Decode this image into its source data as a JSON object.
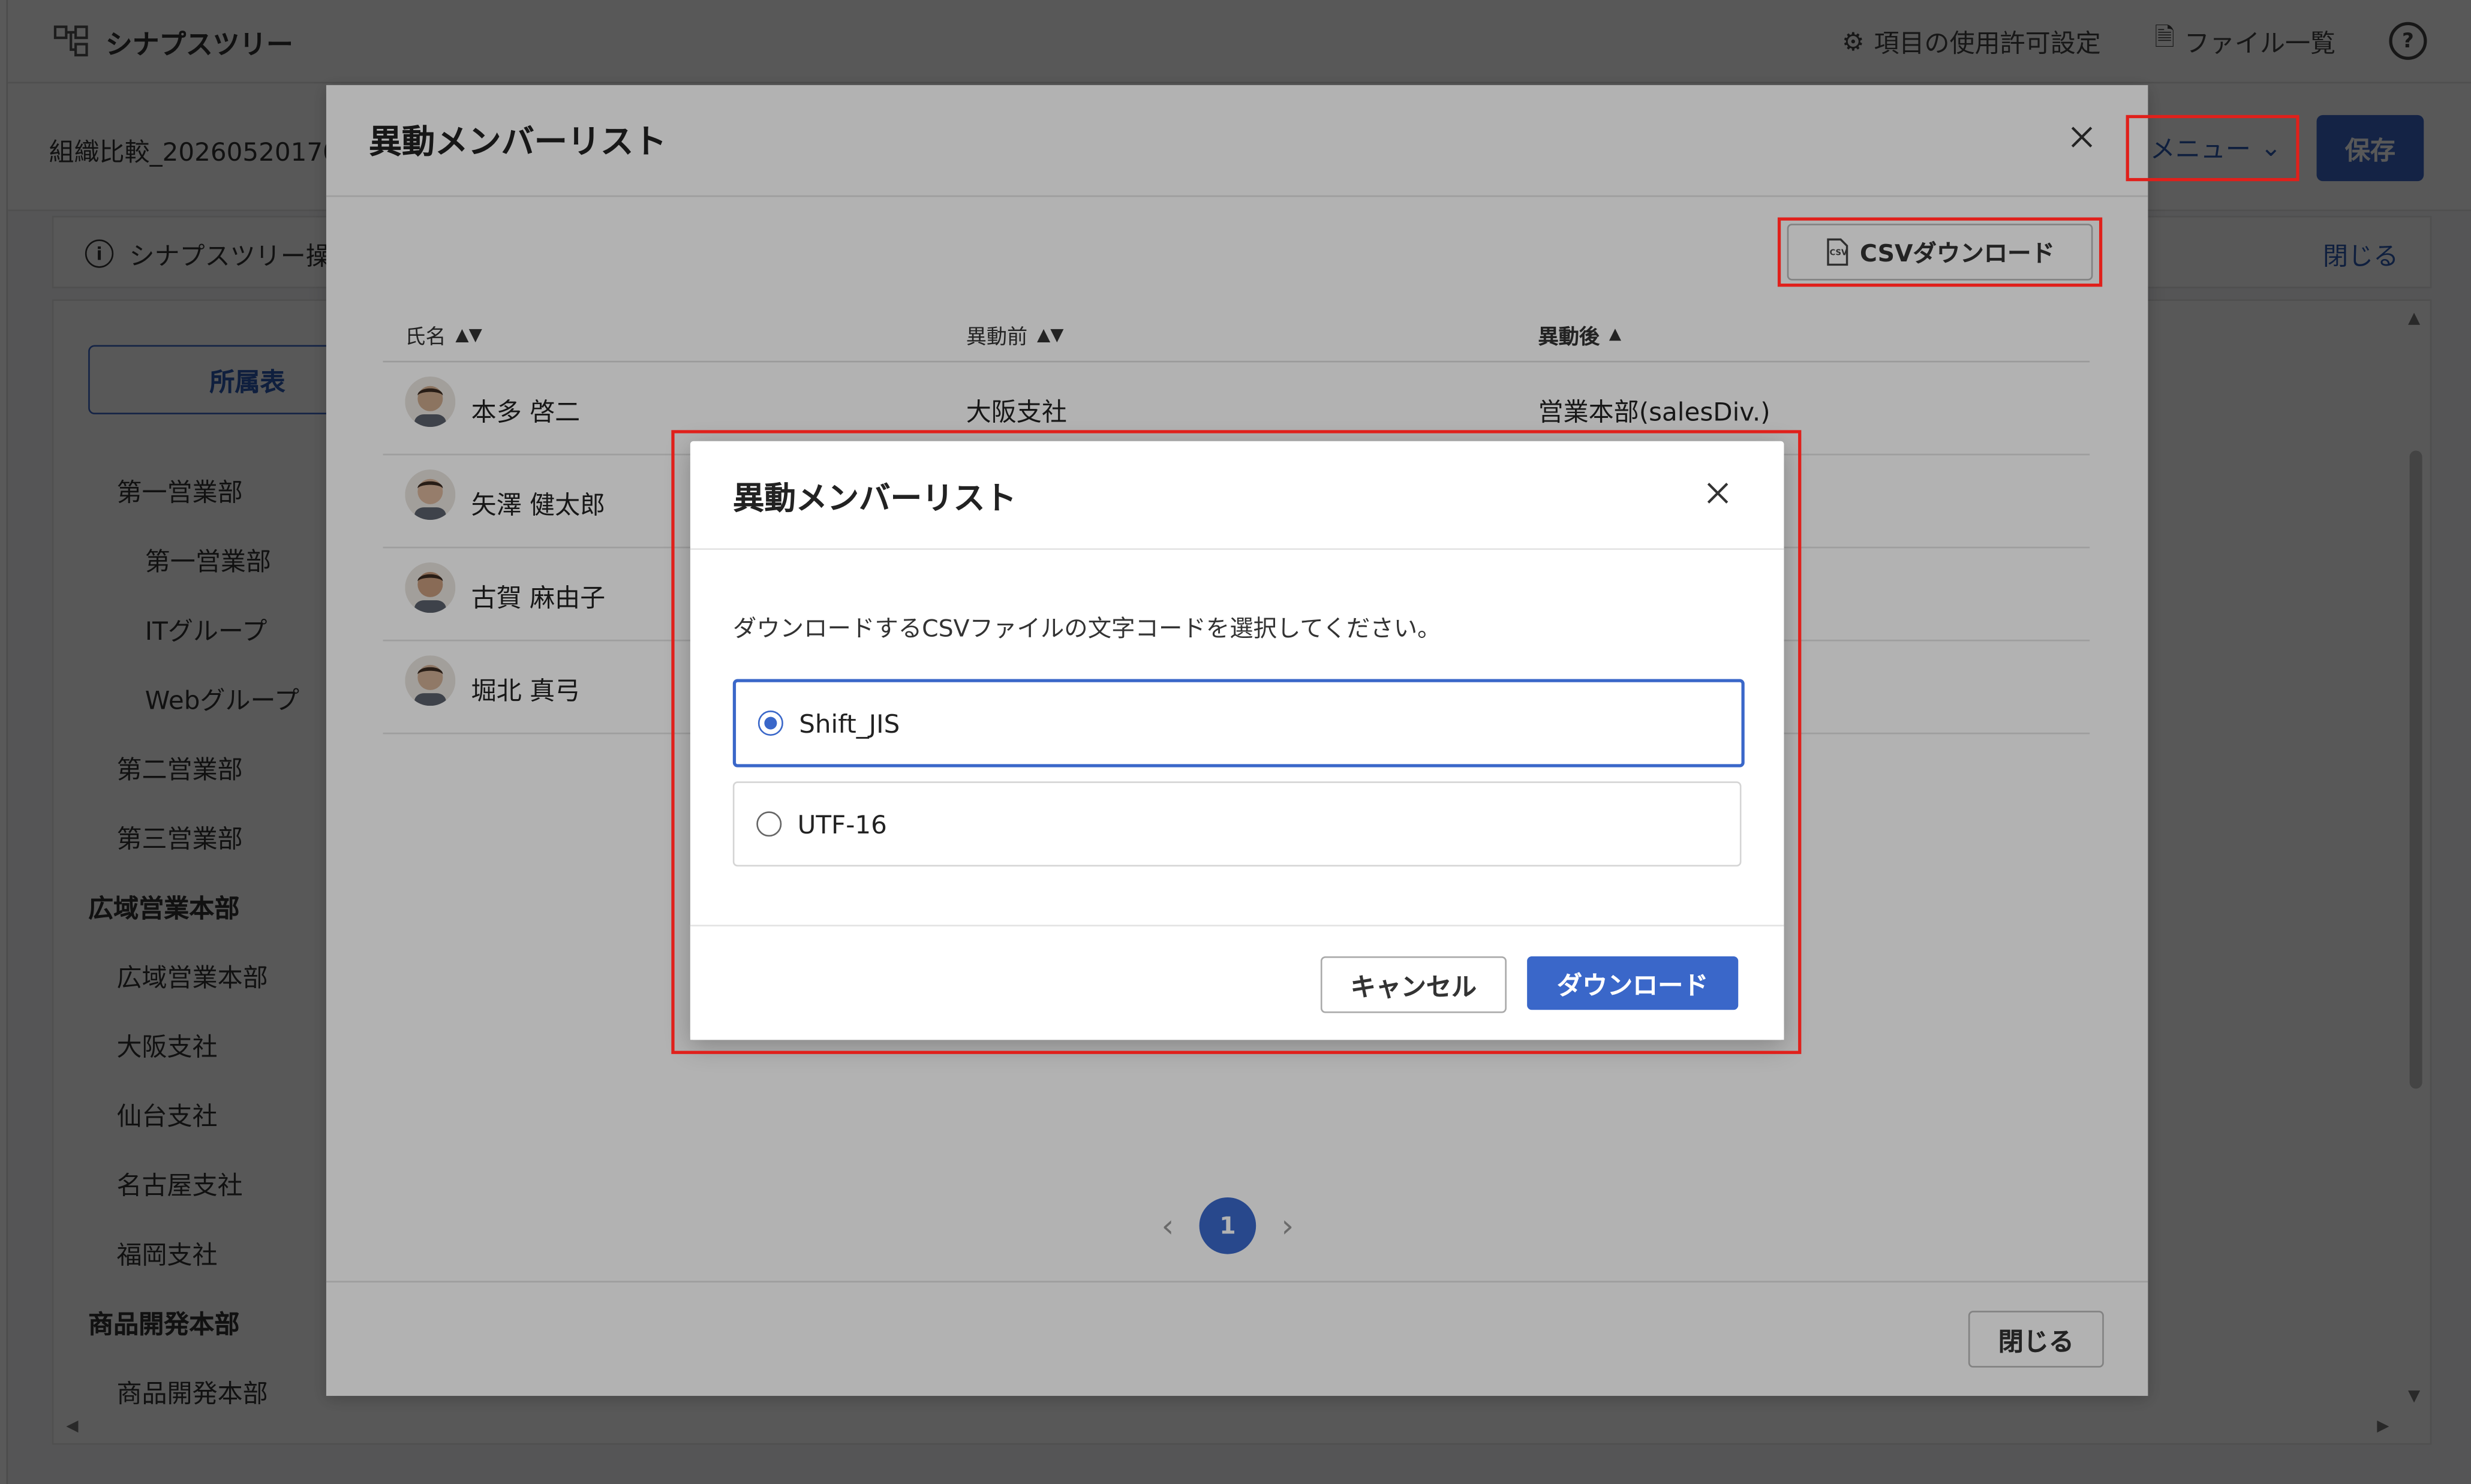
{
  "app": {
    "brand": "シナプスツリー",
    "top_links": {
      "permissions": "項目の使用許可設定",
      "files": "ファイル一覧",
      "help": "?"
    },
    "document_name": "組織比較_20260520170",
    "menu_label": "メニュー",
    "save_label": "保存",
    "info_text": "シナプスツリー操",
    "info_close": "閉じる",
    "left_tab": "所属表",
    "tree": [
      {
        "label": "第一営業部",
        "level": 1
      },
      {
        "label": "第一営業部",
        "level": 2
      },
      {
        "label": "ITグループ",
        "level": 2
      },
      {
        "label": "Webグループ",
        "level": 2
      },
      {
        "label": "第二営業部",
        "level": 1
      },
      {
        "label": "第三営業部",
        "level": 1
      },
      {
        "label": "広域営業本部",
        "level": 0
      },
      {
        "label": "広域営業本部",
        "level": 1
      },
      {
        "label": "大阪支社",
        "level": 1
      },
      {
        "label": "仙台支社",
        "level": 1
      },
      {
        "label": "名古屋支社",
        "level": 1
      },
      {
        "label": "福岡支社",
        "level": 1
      },
      {
        "label": "商品開発本部",
        "level": 0
      },
      {
        "label": "商品開発本部",
        "level": 1
      }
    ]
  },
  "modal": {
    "title": "異動メンバーリスト",
    "csv_button": "CSVダウンロード",
    "columns": {
      "name": "氏名",
      "before": "異動前",
      "after": "異動後"
    },
    "rows": [
      {
        "name": "本多 啓二",
        "before": "大阪支社",
        "after": "営業本部(salesDiv.)"
      },
      {
        "name": "矢澤 健太郎",
        "before": "",
        "after": ""
      },
      {
        "name": "古賀 麻由子",
        "before": "",
        "after": ""
      },
      {
        "name": "堀北 真弓",
        "before": "",
        "after": ""
      }
    ],
    "page_current": "1",
    "close_button": "閉じる"
  },
  "dialog": {
    "title": "異動メンバーリスト",
    "message": "ダウンロードするCSVファイルの文字コードを選択してください。",
    "options": [
      {
        "label": "Shift_JIS",
        "selected": true
      },
      {
        "label": "UTF-16",
        "selected": false
      }
    ],
    "cancel": "キャンセル",
    "download": "ダウンロード"
  },
  "colors": {
    "accent": "#3a67c9",
    "highlight": "#e0201b"
  }
}
